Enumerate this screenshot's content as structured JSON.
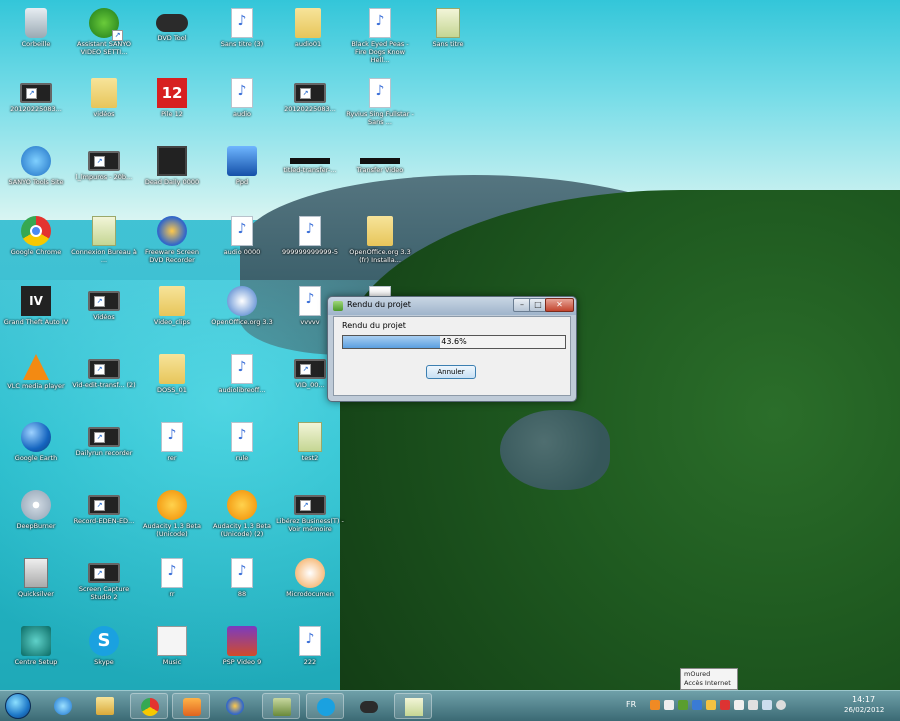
{
  "desktop": {
    "icons": [
      {
        "label": "Corbeille",
        "icon": "recycle-bin-icon"
      },
      {
        "label": "Assistant SANYO VIDEO SETTI...",
        "icon": "green-setup-icon"
      },
      {
        "label": "DVD Tool",
        "icon": "gamepad-icon"
      },
      {
        "label": "Sans titre (3)",
        "icon": "audio-file-icon"
      },
      {
        "label": "audio01",
        "icon": "folder-icon"
      },
      {
        "label": "Black Eyed Peas - Fire Dogs Know Hell...",
        "icon": "mp3-file-icon"
      },
      {
        "label": "Sans titre",
        "icon": "text-file-icon"
      },
      {
        "label": "20120225083...",
        "icon": "video-file-icon"
      },
      {
        "label": "vidéos",
        "icon": "folder-icon"
      },
      {
        "label": "Pile 12",
        "icon": "calendar-12-icon"
      },
      {
        "label": "audio",
        "icon": "audio-file-icon"
      },
      {
        "label": "20120225083...",
        "icon": "video-file-icon"
      },
      {
        "label": "Ryvius Sing Fullstar - Sans ...",
        "icon": "mp3-file-icon"
      },
      {
        "label": "SANYO Tools Site",
        "icon": "sanyo-tools-icon"
      },
      {
        "label": "l_lmpuros - 20b...",
        "icon": "video-file-icon"
      },
      {
        "label": "Dead Daily 0000",
        "icon": "black-video-icon"
      },
      {
        "label": "Ppd",
        "icon": "blue-app-icon"
      },
      {
        "label": "titled-transfer-...",
        "icon": "black-bar-icon"
      },
      {
        "label": "Transfer Video",
        "icon": "black-bar-icon"
      },
      {
        "label": "Google Chrome",
        "icon": "chrome-icon"
      },
      {
        "label": "Connexion Bureau à ...",
        "icon": "remote-desktop-icon"
      },
      {
        "label": "Freeware Screen DVD Recorder",
        "icon": "screen-recorder-icon"
      },
      {
        "label": "audio 0000",
        "icon": "audio-file-icon"
      },
      {
        "label": "999999999999-5",
        "icon": "audio-file-icon"
      },
      {
        "label": "OpenOffice.org 3.3 (fr) Installa...",
        "icon": "folder-icon"
      },
      {
        "label": "Grand Theft Auto IV",
        "icon": "gta-icon"
      },
      {
        "label": "Vidéos",
        "icon": "video-file-icon"
      },
      {
        "label": "Video_clips",
        "icon": "folder-icon"
      },
      {
        "label": "OpenOffice.org 3.3",
        "icon": "openoffice-icon"
      },
      {
        "label": "vvvvv",
        "icon": "audio-file-icon"
      },
      {
        "label": "",
        "icon": "file-icon"
      },
      {
        "label": "VLC media player",
        "icon": "vlc-icon"
      },
      {
        "label": "Vid-edit-transf... (2)",
        "icon": "video-file-icon"
      },
      {
        "label": "DOSS_01",
        "icon": "folder-icon"
      },
      {
        "label": "audiolibreoff...",
        "icon": "audio-file-icon"
      },
      {
        "label": "VID_00...",
        "icon": "video-file-icon"
      },
      {
        "label": "Google Earth",
        "icon": "google-earth-icon"
      },
      {
        "label": "Dailyrun recorder",
        "icon": "video-file-icon"
      },
      {
        "label": "rer",
        "icon": "audio-file-icon"
      },
      {
        "label": "rule",
        "icon": "audio-file-icon"
      },
      {
        "label": "test2",
        "icon": "text-file-icon"
      },
      {
        "label": "DeepBurner",
        "icon": "disc-icon"
      },
      {
        "label": "Record-EDEN-ED...",
        "icon": "video-file-icon"
      },
      {
        "label": "Audacity 1.3 Beta (Unicode)",
        "icon": "audacity-icon"
      },
      {
        "label": "Audacity 1.3 Beta (Unicode) (2)",
        "icon": "audacity-icon"
      },
      {
        "label": "Libérez Business(T) - Voir mémoire",
        "icon": "video-file-icon"
      },
      {
        "label": "Quicksilver",
        "icon": "calculator-icon"
      },
      {
        "label": "Screen Capture Studio 2",
        "icon": "video-file-icon"
      },
      {
        "label": "rr",
        "icon": "audio-file-icon"
      },
      {
        "label": "88",
        "icon": "audio-file-icon"
      },
      {
        "label": "Microdocumen",
        "icon": "coin-icon"
      },
      {
        "label": "Centre Setup",
        "icon": "control-center-icon"
      },
      {
        "label": "Skype",
        "icon": "skype-icon"
      },
      {
        "label": "Music",
        "icon": "headset-icon"
      },
      {
        "label": "PSP Video 9",
        "icon": "psp-icon"
      },
      {
        "label": "222",
        "icon": "audio-file-icon"
      }
    ]
  },
  "dialog": {
    "title": "Rendu du projet",
    "progress_label": "Rendu du projet",
    "progress_text": "43.6%",
    "progress_fraction": 0.436,
    "cancel_label": "Annuler",
    "min_glyph": "–",
    "max_glyph": "□",
    "close_glyph": "✕"
  },
  "taskbar": {
    "items": [
      {
        "icon": "internet-explorer-icon"
      },
      {
        "icon": "file-explorer-icon"
      },
      {
        "icon": "chrome-icon"
      },
      {
        "icon": "media-player-icon"
      },
      {
        "icon": "screen-recorder-icon"
      },
      {
        "icon": "tools-icon"
      },
      {
        "icon": "skype-icon"
      },
      {
        "icon": "gamepad-icon"
      },
      {
        "icon": "notes-icon"
      }
    ],
    "language": "FR",
    "clock_time": "14:17",
    "clock_date": "26/02/2012",
    "network_popup_line1": "mOured",
    "network_popup_line2": "Accès Internet"
  }
}
